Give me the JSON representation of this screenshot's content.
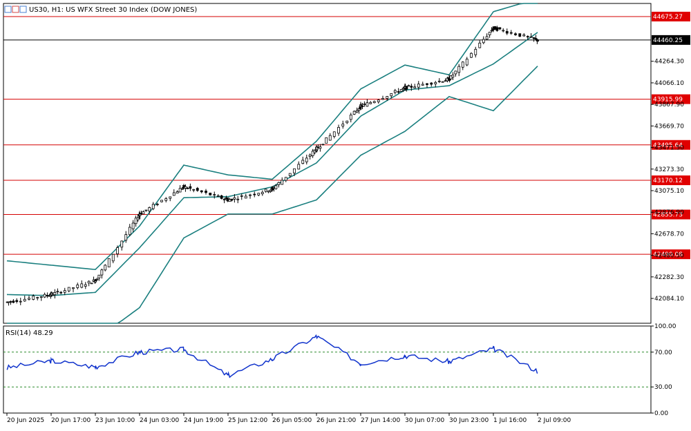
{
  "window": {
    "title": "US30, H1:  US WFX Street 30 Index (DOW JONES)"
  },
  "colors": {
    "candle": "#000000",
    "bollinger": "#1a7f7f",
    "level_line": "#d40000",
    "level_label_bg": "#e00000",
    "current_label_bg": "#000000",
    "rsi_line": "#1033cc",
    "rsi_dash": "#2a8a2a"
  },
  "chart_data": [
    {
      "type": "line",
      "name": "price-panel",
      "series": [
        {
          "name": "US30 H1",
          "x": [
            "20 Jun 2025",
            "20 Jun 17:00",
            "23 Jun 10:00",
            "24 Jun 03:00",
            "24 Jun 19:00",
            "25 Jun 12:00",
            "26 Jun 05:00",
            "26 Jun 21:00",
            "27 Jun 14:00",
            "30 Jun 07:00",
            "30 Jun 23:00",
            "1 Jul 16:00",
            "2 Jul 09:00"
          ],
          "values": [
            42050,
            42120,
            42250,
            42860,
            43110,
            42990,
            43090,
            43460,
            43850,
            44020,
            44100,
            44570,
            44460
          ]
        }
      ],
      "bollinger": {
        "upper": [
          42430,
          42390,
          42350,
          42750,
          43310,
          43220,
          43180,
          43530,
          44010,
          44230,
          44140,
          44720,
          44840
        ],
        "middle": [
          42120,
          42110,
          42140,
          42550,
          43010,
          43020,
          43110,
          43330,
          43760,
          44000,
          44040,
          44240,
          44530
        ],
        "lower": [
          41800,
          41780,
          41700,
          42000,
          42640,
          42860,
          42860,
          42990,
          43400,
          43620,
          43940,
          43810,
          44220
        ]
      },
      "y_ticks": [
        44264.3,
        44066.1,
        43867.9,
        43669.7,
        43471.5,
        43273.3,
        43075.1,
        42876.9,
        42678.7,
        42480.5,
        42282.3,
        42084.1
      ],
      "levels": [
        44675.27,
        43915.99,
        43495.64,
        43170.12,
        42855.73,
        42490.08
      ],
      "current_price": 44460.25,
      "ylim": [
        41856,
        44796
      ],
      "grid": false
    },
    {
      "type": "line",
      "name": "RSI(14)",
      "label": "RSI(14) 48.29",
      "series": [
        {
          "name": "RSI(14)",
          "x": [
            "20 Jun 2025",
            "20 Jun 17:00",
            "23 Jun 10:00",
            "24 Jun 03:00",
            "24 Jun 19:00",
            "25 Jun 12:00",
            "26 Jun 05:00",
            "26 Jun 21:00",
            "27 Jun 14:00",
            "30 Jun 07:00",
            "30 Jun 23:00",
            "1 Jul 16:00",
            "2 Jul 09:00"
          ],
          "values": [
            52,
            60,
            53,
            70,
            73,
            43,
            62,
            88,
            57,
            66,
            59,
            74,
            48.29
          ]
        }
      ],
      "y_ticks": [
        100.0,
        70.0,
        30.0,
        0.0
      ],
      "levels": [
        70,
        30
      ],
      "ylim": [
        0,
        100
      ],
      "grid": false
    }
  ],
  "x_labels": [
    "20 Jun 2025",
    "20 Jun 17:00",
    "23 Jun 10:00",
    "24 Jun 03:00",
    "24 Jun 19:00",
    "25 Jun 12:00",
    "26 Jun 05:00",
    "26 Jun 21:00",
    "27 Jun 14:00",
    "30 Jun 07:00",
    "30 Jun 23:00",
    "1 Jul 16:00",
    "2 Jul 09:00"
  ]
}
